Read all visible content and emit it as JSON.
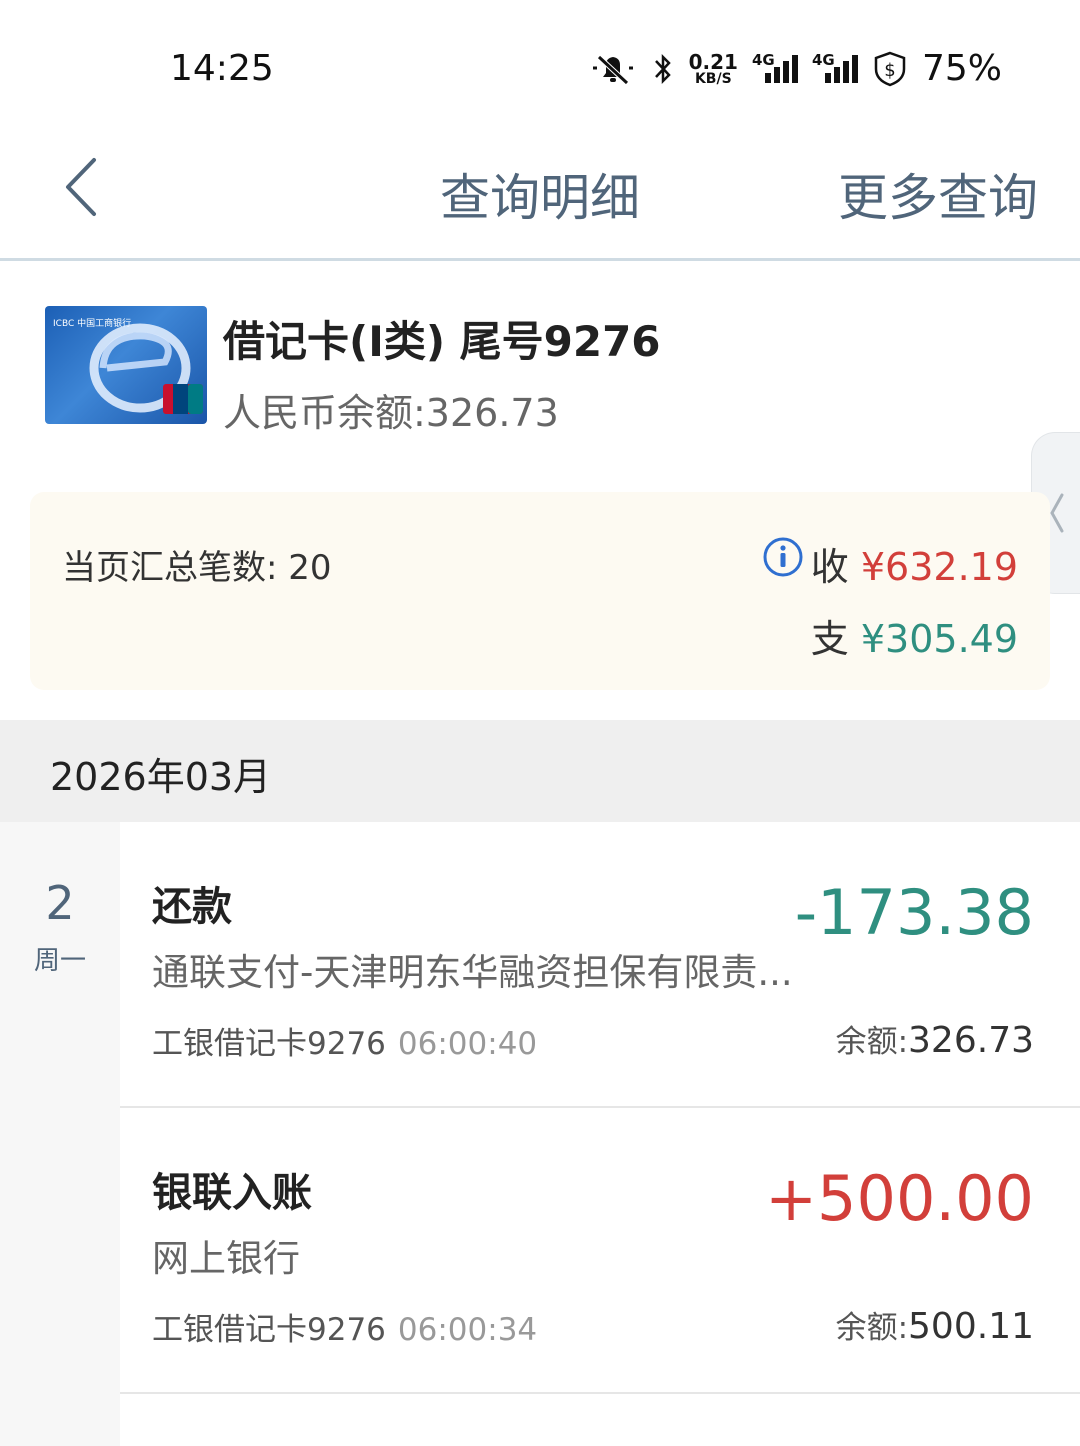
{
  "status_bar": {
    "time": "14:25",
    "net_speed_value": "0.21",
    "net_speed_unit": "KB/S",
    "signal1_label": "4G",
    "signal2_label": "4G",
    "battery": "75%",
    "icons": [
      "bell-off-icon",
      "bluetooth-icon",
      "signal-icon",
      "signal-icon",
      "shield-dollar-icon"
    ]
  },
  "header": {
    "title": "查询明细",
    "more_label": "更多查询",
    "back_icon": "chevron-left-icon"
  },
  "account": {
    "title": "借记卡(I类) 尾号9276",
    "balance": "人民币余额:326.73",
    "card_brand": "ICBC 中国工商银行"
  },
  "summary": {
    "count_text": "当页汇总笔数: 20",
    "income_label": "收",
    "income_amount": "¥632.19",
    "expense_label": "支",
    "expense_amount": "¥305.49"
  },
  "month": {
    "label": "2026年03月"
  },
  "date": {
    "day": "2",
    "weekday": "周一"
  },
  "transactions": [
    {
      "title": "还款",
      "desc": "通联支付-天津明东华融资担保有限责...",
      "account": "工银借记卡9276",
      "time": "06:00:40",
      "amount": "-173.38",
      "balance_label": "余额:",
      "balance_value": "326.73"
    },
    {
      "title": "银联入账",
      "desc": "网上银行",
      "account": "工银借记卡9276",
      "time": "06:00:34",
      "amount": "+500.00",
      "balance_label": "余额:",
      "balance_value": "500.11"
    }
  ],
  "colors": {
    "header_text": "#50657a",
    "income_red": "#d23f3a",
    "expense_green": "#2f8f80",
    "summary_bg": "#fdfaf2",
    "month_bg": "#efefef"
  }
}
